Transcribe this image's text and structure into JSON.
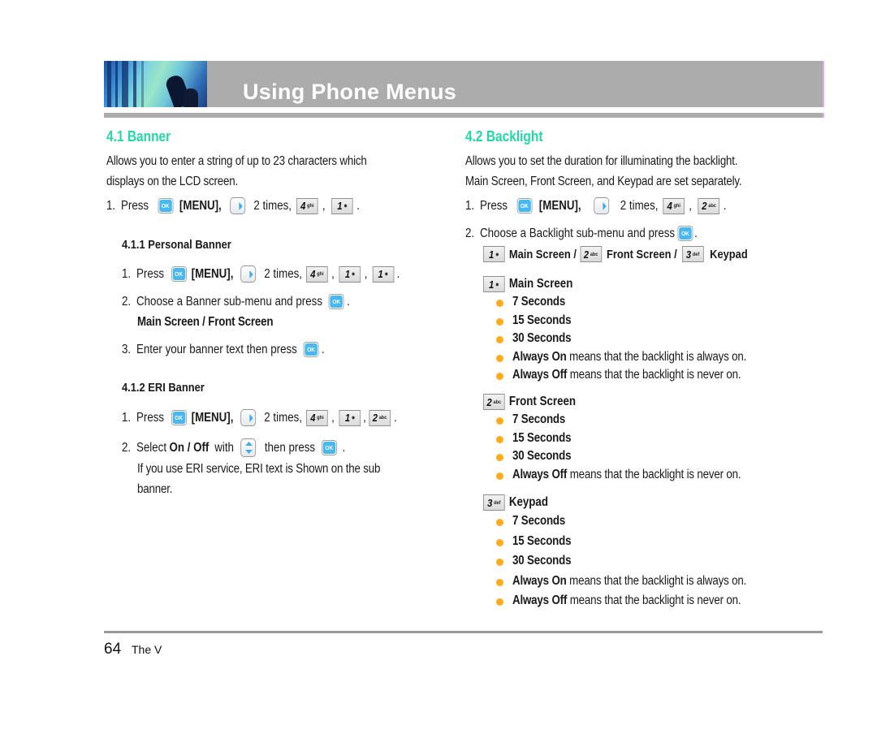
{
  "header": {
    "title": "Using Phone Menus",
    "band_color": "#acacac",
    "accent_color": "#e8a6e6"
  },
  "colors": {
    "section_title": "#25d7a6",
    "bullet": "#ffab1b",
    "ok_key": "#49b8f0"
  },
  "icons": {
    "ok": "OK",
    "key4": {
      "num": "4",
      "letters": "ghi"
    },
    "key1": {
      "num": "1",
      "glyph": "voicemail"
    },
    "key2": {
      "num": "2",
      "letters": "abc"
    },
    "key3": {
      "num": "3",
      "letters": "def"
    }
  },
  "left": {
    "section_title": "4.1 Banner",
    "intro_line1": "Allows you to enter a string of up to 23 characters which",
    "intro_line2": "displays on the LCD screen.",
    "step1": {
      "num": "1.",
      "press": "Press",
      "menu": "[MENU],",
      "times": "2 times,",
      "sep": ",",
      "end": "."
    },
    "personal_banner": {
      "title": "4.1.1 Personal Banner",
      "step1": {
        "num": "1.",
        "press": "Press",
        "menu": "[MENU],",
        "times": "2 times,",
        "sep": ",",
        "end": "."
      },
      "step2": {
        "num": "2.",
        "text": "Choose a Banner sub-menu and press",
        "end": "."
      },
      "step2_options": "Main Screen / Front Screen",
      "step3": {
        "num": "3.",
        "text": "Enter your banner text then press",
        "end": "."
      }
    },
    "eri_banner": {
      "title": "4.1.2 ERI Banner",
      "step1": {
        "num": "1.",
        "press": "Press",
        "menu": "[MENU],",
        "times": "2 times,",
        "sep": ",",
        "end": "."
      },
      "step2": {
        "num": "2.",
        "select": "Select",
        "options": "On / Off",
        "with": "with",
        "then": "then press",
        "end": "."
      },
      "note_line1": "If you use ERI service, ERI text is Shown on the sub",
      "note_line2": "banner."
    }
  },
  "right": {
    "section_title": "4.2 Backlight",
    "intro_line1": "Allows you to set the duration for illuminating the backlight.",
    "intro_line2": "Main Screen, Front Screen, and Keypad are set separately.",
    "step1": {
      "num": "1.",
      "press": "Press",
      "menu": "[MENU],",
      "times": "2 times,",
      "sep": ",",
      "end": "."
    },
    "step2": {
      "num": "2.",
      "text": "Choose a Backlight sub-menu and press",
      "end": "."
    },
    "step2_options": {
      "main": "Main Screen /",
      "front": "Front Screen /",
      "keypad": "Keypad"
    },
    "main_screen": {
      "title": "Main Screen",
      "items": [
        {
          "bold": "7 Seconds",
          "rest": ""
        },
        {
          "bold": "15 Seconds",
          "rest": ""
        },
        {
          "bold": "30 Seconds",
          "rest": ""
        },
        {
          "bold": "Always On",
          "rest": " means that the backlight is always on."
        },
        {
          "bold": "Always Off",
          "rest": " means that the backlight is never on."
        }
      ]
    },
    "front_screen": {
      "title": "Front Screen",
      "items": [
        {
          "bold": "7 Seconds",
          "rest": ""
        },
        {
          "bold": "15 Seconds",
          "rest": ""
        },
        {
          "bold": "30 Seconds",
          "rest": ""
        },
        {
          "bold": "Always Off",
          "rest": " means that the backlight is never on."
        }
      ]
    },
    "keypad": {
      "title": "Keypad",
      "items": [
        {
          "bold": "7 Seconds",
          "rest": ""
        },
        {
          "bold": "15 Seconds",
          "rest": ""
        },
        {
          "bold": "30 Seconds",
          "rest": ""
        },
        {
          "bold": "Always On",
          "rest": " means that the backlight is always on."
        },
        {
          "bold": "Always Off",
          "rest": " means that the backlight is never on."
        }
      ]
    }
  },
  "footer": {
    "page_number": "64",
    "product_name": "The V"
  }
}
